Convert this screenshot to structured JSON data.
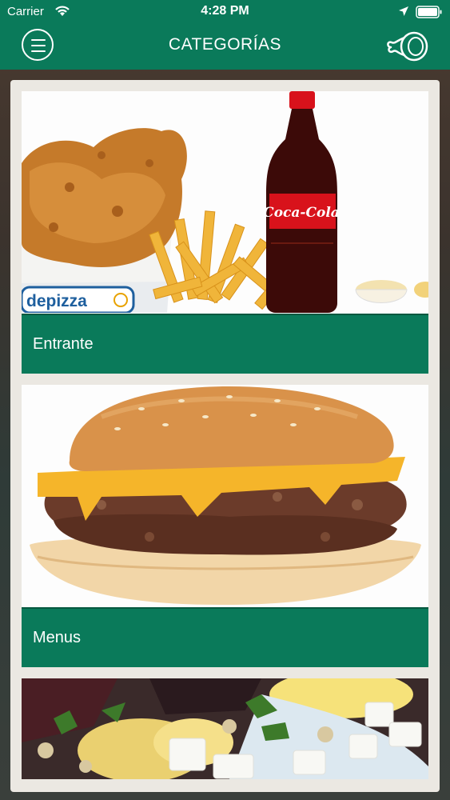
{
  "status_bar": {
    "carrier": "Carrier",
    "time": "4:28 PM"
  },
  "header": {
    "title": "CATEGORÍAS",
    "menu_icon": "hamburger-menu-icon",
    "right_icon": "ham-meat-icon"
  },
  "categories": [
    {
      "label": "Entrante",
      "image": "fried-chicken-fries-cola-photo",
      "brand_text": "depizza",
      "cola_text": "Coca-Cola"
    },
    {
      "label": "Menus",
      "image": "double-cheeseburger-photo"
    },
    {
      "label": "",
      "image": "salad-photo"
    }
  ],
  "colors": {
    "primary": "#0a7a5a",
    "panel": "#ebe8e2"
  }
}
